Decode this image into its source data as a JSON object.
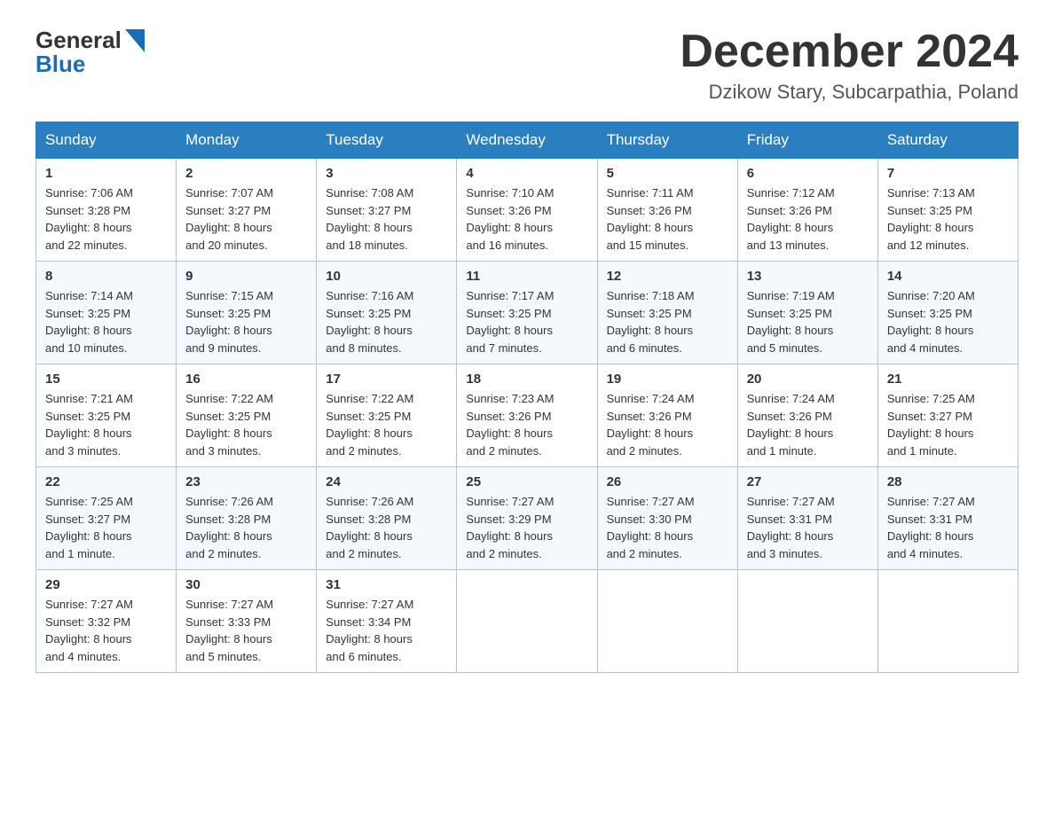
{
  "header": {
    "logo_general": "General",
    "logo_blue": "Blue",
    "month_title": "December 2024",
    "location": "Dzikow Stary, Subcarpathia, Poland"
  },
  "days_of_week": [
    "Sunday",
    "Monday",
    "Tuesday",
    "Wednesday",
    "Thursday",
    "Friday",
    "Saturday"
  ],
  "weeks": [
    [
      {
        "day": "1",
        "sunrise": "7:06 AM",
        "sunset": "3:28 PM",
        "daylight": "8 hours and 22 minutes."
      },
      {
        "day": "2",
        "sunrise": "7:07 AM",
        "sunset": "3:27 PM",
        "daylight": "8 hours and 20 minutes."
      },
      {
        "day": "3",
        "sunrise": "7:08 AM",
        "sunset": "3:27 PM",
        "daylight": "8 hours and 18 minutes."
      },
      {
        "day": "4",
        "sunrise": "7:10 AM",
        "sunset": "3:26 PM",
        "daylight": "8 hours and 16 minutes."
      },
      {
        "day": "5",
        "sunrise": "7:11 AM",
        "sunset": "3:26 PM",
        "daylight": "8 hours and 15 minutes."
      },
      {
        "day": "6",
        "sunrise": "7:12 AM",
        "sunset": "3:26 PM",
        "daylight": "8 hours and 13 minutes."
      },
      {
        "day": "7",
        "sunrise": "7:13 AM",
        "sunset": "3:25 PM",
        "daylight": "8 hours and 12 minutes."
      }
    ],
    [
      {
        "day": "8",
        "sunrise": "7:14 AM",
        "sunset": "3:25 PM",
        "daylight": "8 hours and 10 minutes."
      },
      {
        "day": "9",
        "sunrise": "7:15 AM",
        "sunset": "3:25 PM",
        "daylight": "8 hours and 9 minutes."
      },
      {
        "day": "10",
        "sunrise": "7:16 AM",
        "sunset": "3:25 PM",
        "daylight": "8 hours and 8 minutes."
      },
      {
        "day": "11",
        "sunrise": "7:17 AM",
        "sunset": "3:25 PM",
        "daylight": "8 hours and 7 minutes."
      },
      {
        "day": "12",
        "sunrise": "7:18 AM",
        "sunset": "3:25 PM",
        "daylight": "8 hours and 6 minutes."
      },
      {
        "day": "13",
        "sunrise": "7:19 AM",
        "sunset": "3:25 PM",
        "daylight": "8 hours and 5 minutes."
      },
      {
        "day": "14",
        "sunrise": "7:20 AM",
        "sunset": "3:25 PM",
        "daylight": "8 hours and 4 minutes."
      }
    ],
    [
      {
        "day": "15",
        "sunrise": "7:21 AM",
        "sunset": "3:25 PM",
        "daylight": "8 hours and 3 minutes."
      },
      {
        "day": "16",
        "sunrise": "7:22 AM",
        "sunset": "3:25 PM",
        "daylight": "8 hours and 3 minutes."
      },
      {
        "day": "17",
        "sunrise": "7:22 AM",
        "sunset": "3:25 PM",
        "daylight": "8 hours and 2 minutes."
      },
      {
        "day": "18",
        "sunrise": "7:23 AM",
        "sunset": "3:26 PM",
        "daylight": "8 hours and 2 minutes."
      },
      {
        "day": "19",
        "sunrise": "7:24 AM",
        "sunset": "3:26 PM",
        "daylight": "8 hours and 2 minutes."
      },
      {
        "day": "20",
        "sunrise": "7:24 AM",
        "sunset": "3:26 PM",
        "daylight": "8 hours and 1 minute."
      },
      {
        "day": "21",
        "sunrise": "7:25 AM",
        "sunset": "3:27 PM",
        "daylight": "8 hours and 1 minute."
      }
    ],
    [
      {
        "day": "22",
        "sunrise": "7:25 AM",
        "sunset": "3:27 PM",
        "daylight": "8 hours and 1 minute."
      },
      {
        "day": "23",
        "sunrise": "7:26 AM",
        "sunset": "3:28 PM",
        "daylight": "8 hours and 2 minutes."
      },
      {
        "day": "24",
        "sunrise": "7:26 AM",
        "sunset": "3:28 PM",
        "daylight": "8 hours and 2 minutes."
      },
      {
        "day": "25",
        "sunrise": "7:27 AM",
        "sunset": "3:29 PM",
        "daylight": "8 hours and 2 minutes."
      },
      {
        "day": "26",
        "sunrise": "7:27 AM",
        "sunset": "3:30 PM",
        "daylight": "8 hours and 2 minutes."
      },
      {
        "day": "27",
        "sunrise": "7:27 AM",
        "sunset": "3:31 PM",
        "daylight": "8 hours and 3 minutes."
      },
      {
        "day": "28",
        "sunrise": "7:27 AM",
        "sunset": "3:31 PM",
        "daylight": "8 hours and 4 minutes."
      }
    ],
    [
      {
        "day": "29",
        "sunrise": "7:27 AM",
        "sunset": "3:32 PM",
        "daylight": "8 hours and 4 minutes."
      },
      {
        "day": "30",
        "sunrise": "7:27 AM",
        "sunset": "3:33 PM",
        "daylight": "8 hours and 5 minutes."
      },
      {
        "day": "31",
        "sunrise": "7:27 AM",
        "sunset": "3:34 PM",
        "daylight": "8 hours and 6 minutes."
      },
      null,
      null,
      null,
      null
    ]
  ],
  "labels": {
    "sunrise": "Sunrise:",
    "sunset": "Sunset:",
    "daylight": "Daylight:"
  }
}
